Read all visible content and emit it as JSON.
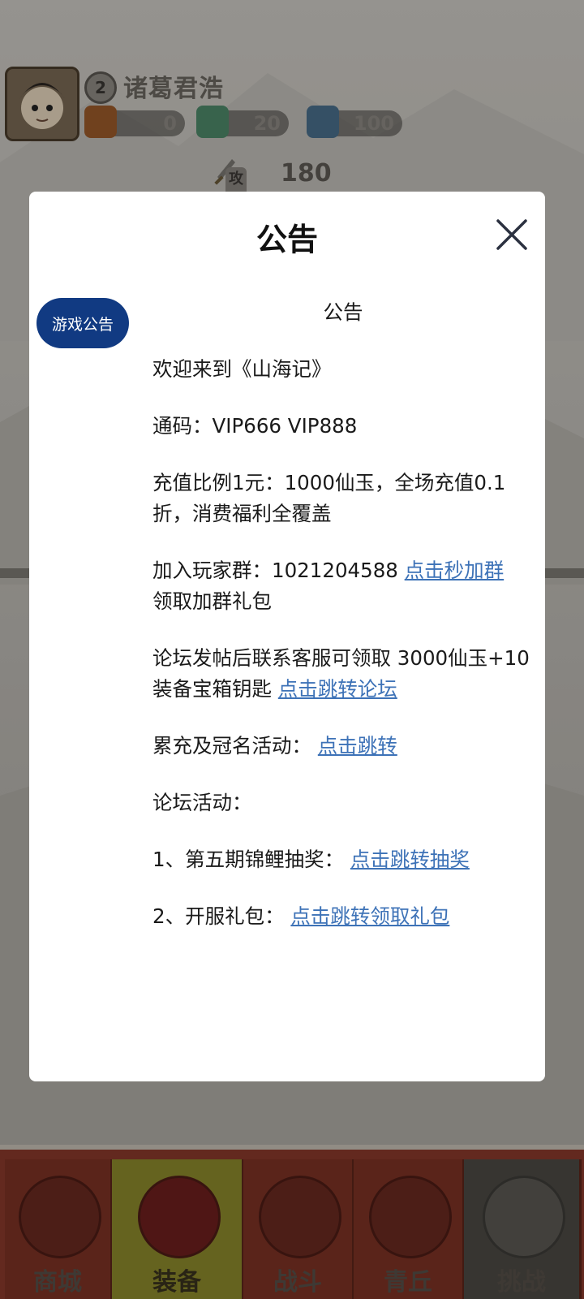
{
  "player": {
    "name": "诸葛君浩",
    "level": "2",
    "resources": [
      {
        "icon": "gift-bag-icon",
        "value": "0"
      },
      {
        "icon": "jade-icon",
        "value": "20"
      },
      {
        "icon": "crystal-icon",
        "value": "100"
      }
    ],
    "attack_label": "攻击",
    "attack_value": "180"
  },
  "modal": {
    "title": "公告",
    "side_tab_label": "游戏公告",
    "content_title": "公告",
    "welcome": "欢迎来到《山海记》",
    "codes": "通码：VIP666 VIP888",
    "recharge": "充值比例1元：1000仙玉，全场充值0.1折，消费福利全覆盖",
    "group_text": "加入玩家群：1021204588 ",
    "group_link": "点击秒加群",
    "group_gift": "领取加群礼包",
    "forum_text": "论坛发帖后联系客服可领取 3000仙玉+10装备宝箱钥匙 ",
    "forum_link": "点击跳转论坛",
    "event_text": "累充及冠名活动： ",
    "event_link": "点击跳转",
    "forum_event_title": "论坛活动：",
    "lottery_text": "1、第五期锦鲤抽奖： ",
    "lottery_link": "点击跳转抽奖",
    "gift_text": "2、开服礼包： ",
    "gift_link": "点击跳转领取礼包"
  },
  "bottom_nav": [
    {
      "label": "商城"
    },
    {
      "label": "装备"
    },
    {
      "label": "战斗"
    },
    {
      "label": "青丘"
    },
    {
      "label": "挑战"
    }
  ],
  "colors": {
    "tab_active": "#113a82",
    "link": "#3d72b7",
    "modal_bg": "#ffffff"
  }
}
